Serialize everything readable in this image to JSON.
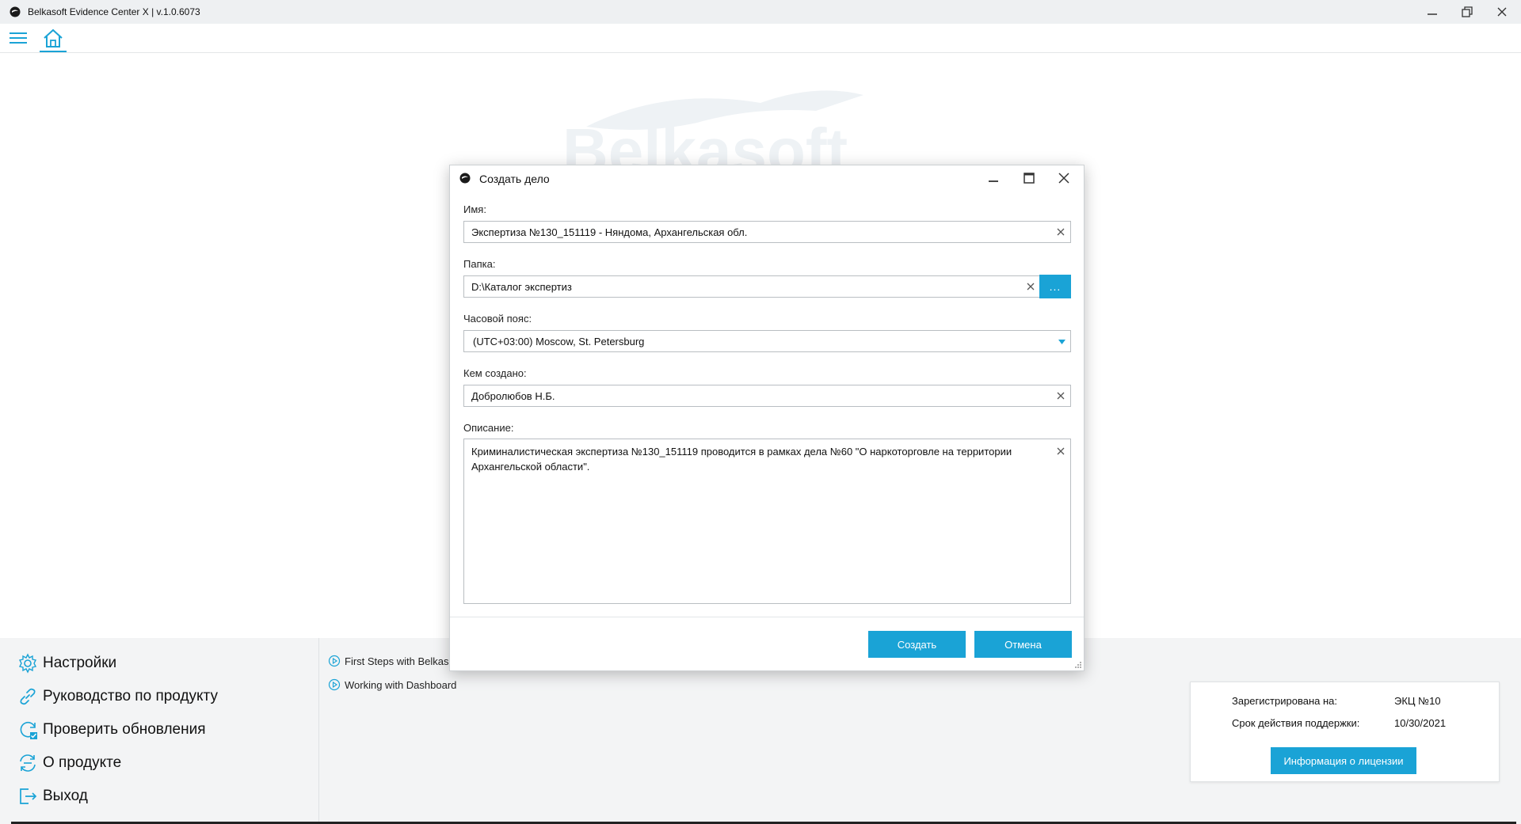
{
  "window": {
    "title": "Belkasoft Evidence Center X | v.1.0.6073",
    "watermark": "Belkasoft"
  },
  "menu": {
    "items": [
      {
        "label": "Настройки",
        "icon": "gear-icon"
      },
      {
        "label": "Руководство по продукту",
        "icon": "link-icon"
      },
      {
        "label": "Проверить обновления",
        "icon": "refresh-check-icon"
      },
      {
        "label": "О продукте",
        "icon": "info-cycle-icon"
      },
      {
        "label": "Выход",
        "icon": "exit-icon"
      }
    ]
  },
  "guides": [
    {
      "label": "First Steps with Belkasoft"
    },
    {
      "label": "Working with Dashboard"
    }
  ],
  "license": {
    "registered_label": "Зарегистрирована на:",
    "registered_value": "ЭКЦ №10",
    "support_label": "Срок действия поддержки:",
    "support_value": "10/30/2021",
    "button": "Информация о лицензии"
  },
  "dialog": {
    "title": "Создать дело",
    "name_label": "Имя:",
    "name_value": "Экспертиза №130_151119 - Няндома, Архангельская обл.",
    "folder_label": "Папка:",
    "folder_value": "D:\\Каталог экспертиз",
    "browse_label": "...",
    "timezone_label": "Часовой пояс:",
    "timezone_value": "(UTC+03:00) Moscow, St. Petersburg",
    "created_by_label": "Кем создано:",
    "created_by_value": "Добролюбов Н.Б.",
    "description_label": "Описание:",
    "description_value": "Криминалистическая экспертиза №130_151119 проводится в рамках дела №60 \"О наркоторговле на территории Архангельской области\".",
    "create_button": "Создать",
    "cancel_button": "Отмена"
  },
  "colors": {
    "accent": "#1aa3d6",
    "titlebar": "#eef0f2",
    "panel": "#f3f4f5"
  }
}
